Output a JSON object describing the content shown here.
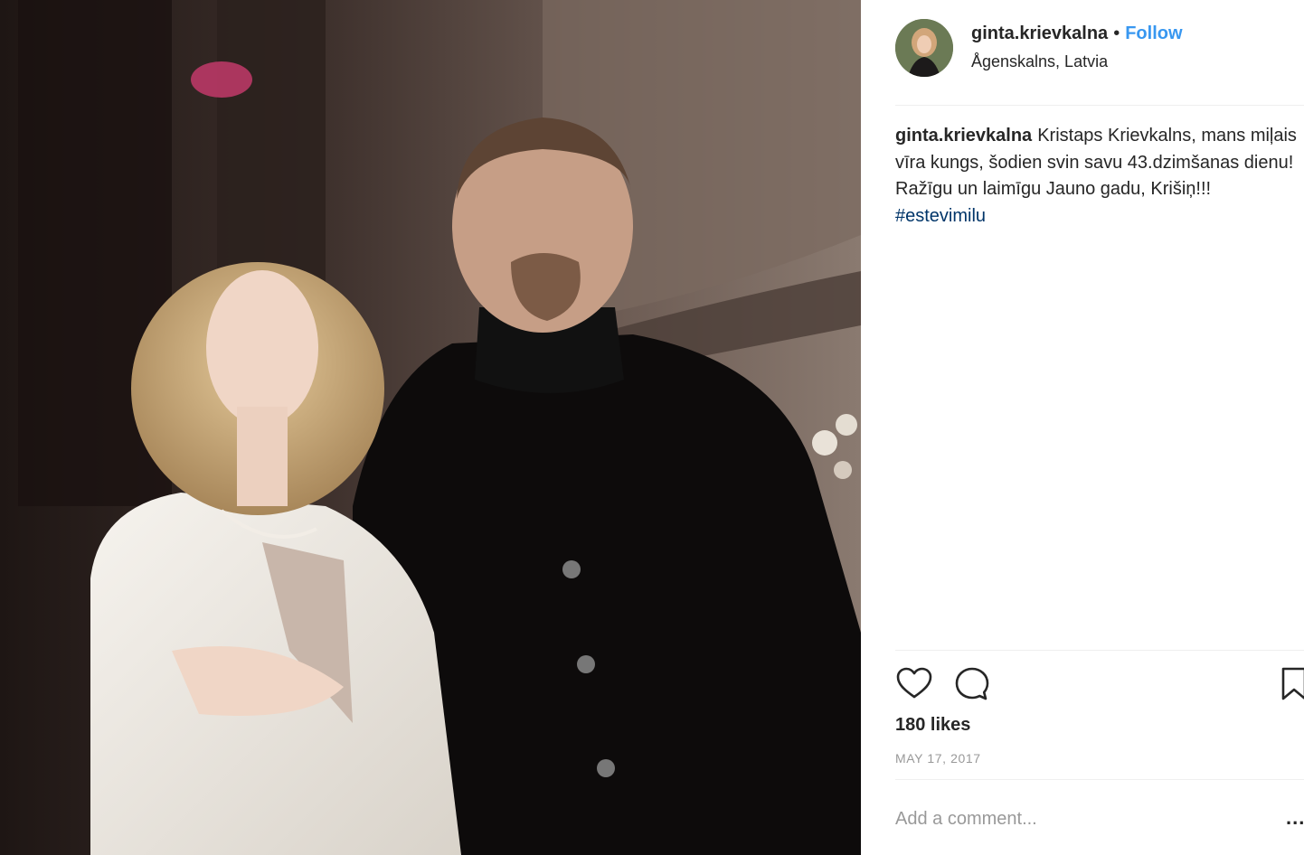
{
  "post": {
    "username": "ginta.krievkalna",
    "separator": "•",
    "follow_label": "Follow",
    "location": "Ågenskalns, Latvia"
  },
  "caption": {
    "username": "ginta.krievkalna",
    "text": "Kristaps Krievkalns, mans miļais vīra kungs, šodien svin savu 43.dzimšanas dienu! Ražīgu un laimīgu Jauno gadu, Krišiņ!!! ",
    "hashtag": "#estevimilu"
  },
  "actions": {
    "like_icon": "heart-icon",
    "comment_icon": "comment-icon",
    "save_icon": "bookmark-icon"
  },
  "likes": "180 likes",
  "date": "MAY 17, 2017",
  "comment": {
    "placeholder": "Add a comment...",
    "more_label": "..."
  },
  "colors": {
    "follow": "#3897f0",
    "hashtag": "#003569",
    "muted": "#999999",
    "text": "#262626"
  }
}
